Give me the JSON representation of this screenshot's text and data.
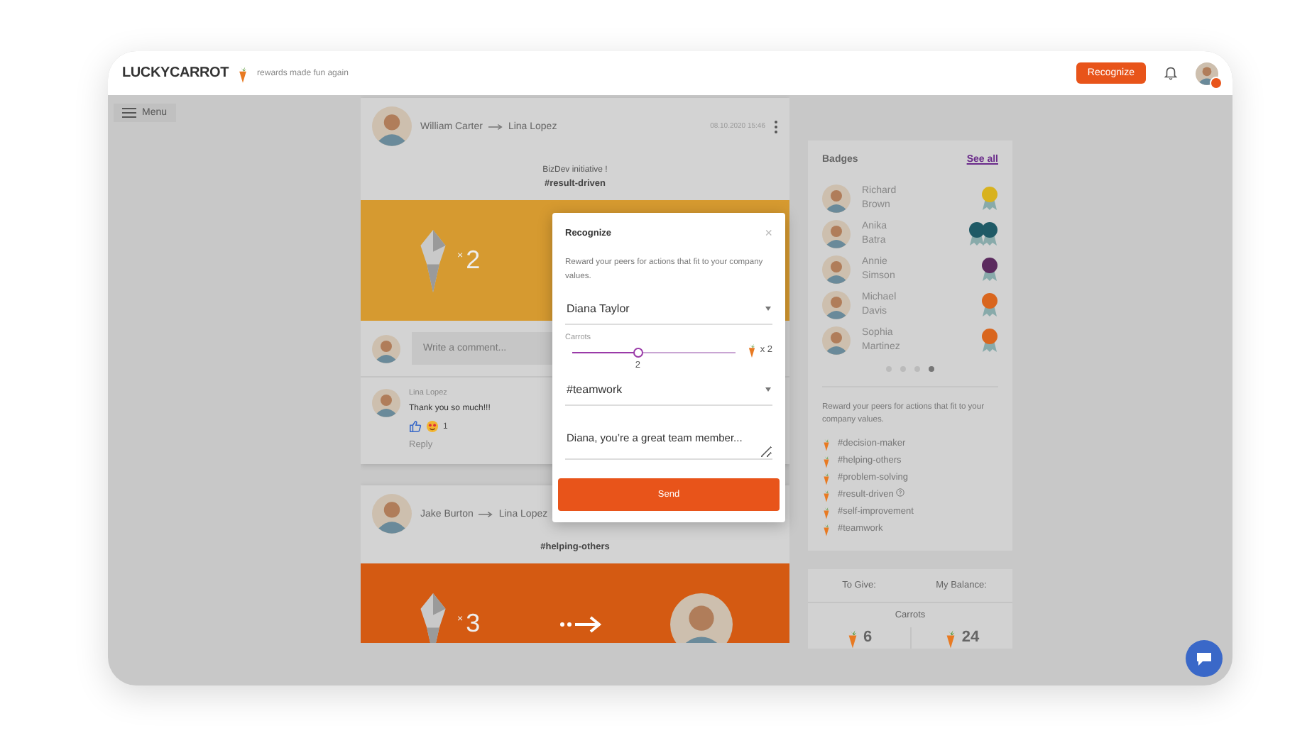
{
  "header": {
    "logo": "LUCKYCARROT",
    "tagline": "rewards made fun again",
    "recognize_button": "Recognize"
  },
  "menu_button": "Menu",
  "feed": {
    "posts": [
      {
        "from": "William Carter",
        "to": "Lina Lopez",
        "timestamp": "08.10.2020 15:46",
        "message": "BizDev initiative !",
        "hashtag": "#result-driven",
        "times": "×",
        "count": "2",
        "color": "#d69a30",
        "comment_placeholder": "Write a comment...",
        "comments": [
          {
            "author": "Lina Lopez",
            "text": "Thank you so much!!!",
            "reaction_count": "1",
            "reply": "Reply"
          }
        ]
      },
      {
        "from": "Jake Burton",
        "to": "Lina Lopez",
        "hashtag": "#helping-others",
        "times": "×",
        "count": "3",
        "color": "#d45a12"
      }
    ]
  },
  "modal": {
    "title": "Recognize",
    "close": "×",
    "description": "Reward your peers for actions that fit to your company values.",
    "recipient": "Diana Taylor",
    "carrots_label": "Carrots",
    "slider": {
      "level": 0.4,
      "value": "2"
    },
    "carrot_count": "x 2",
    "hashtag": "#teamwork",
    "message": "Diana, you’re a great team member...",
    "send_button": "Send"
  },
  "badges": {
    "title": "Badges",
    "see_all": "See all",
    "people": [
      {
        "first": "Richard",
        "last": "Brown",
        "medals": [
          {
            "color": "#d8b21e"
          }
        ]
      },
      {
        "first": "Anika",
        "last": "Batra",
        "medals": [
          {
            "color": "#1f5a66"
          },
          {
            "color": "#1f5a66"
          }
        ]
      },
      {
        "first": "Annie",
        "last": "Simson",
        "medals": [
          {
            "color": "#5b2a5e"
          }
        ]
      },
      {
        "first": "Michael",
        "last": "Davis",
        "medals": [
          {
            "color": "#d9661e"
          }
        ]
      },
      {
        "first": "Sophia",
        "last": "Martinez",
        "medals": [
          {
            "color": "#d9661e"
          }
        ]
      }
    ],
    "pages": [
      {
        "selected": false
      },
      {
        "selected": false
      },
      {
        "selected": false
      },
      {
        "selected": true
      }
    ]
  },
  "values": {
    "description": "Reward your peers for actions that fit to your company values.",
    "items": [
      {
        "label": "#decision-maker",
        "help": false
      },
      {
        "label": "#helping-others",
        "help": false
      },
      {
        "label": "#problem-solving",
        "help": false
      },
      {
        "label": "#result-driven",
        "help": true
      },
      {
        "label": "#self-improvement",
        "help": false
      },
      {
        "label": "#teamwork",
        "help": false
      }
    ]
  },
  "balance": {
    "to_give_label": "To Give:",
    "my_balance_label": "My Balance:",
    "carrots_label": "Carrots",
    "to_give": "6",
    "my_balance": "24"
  }
}
